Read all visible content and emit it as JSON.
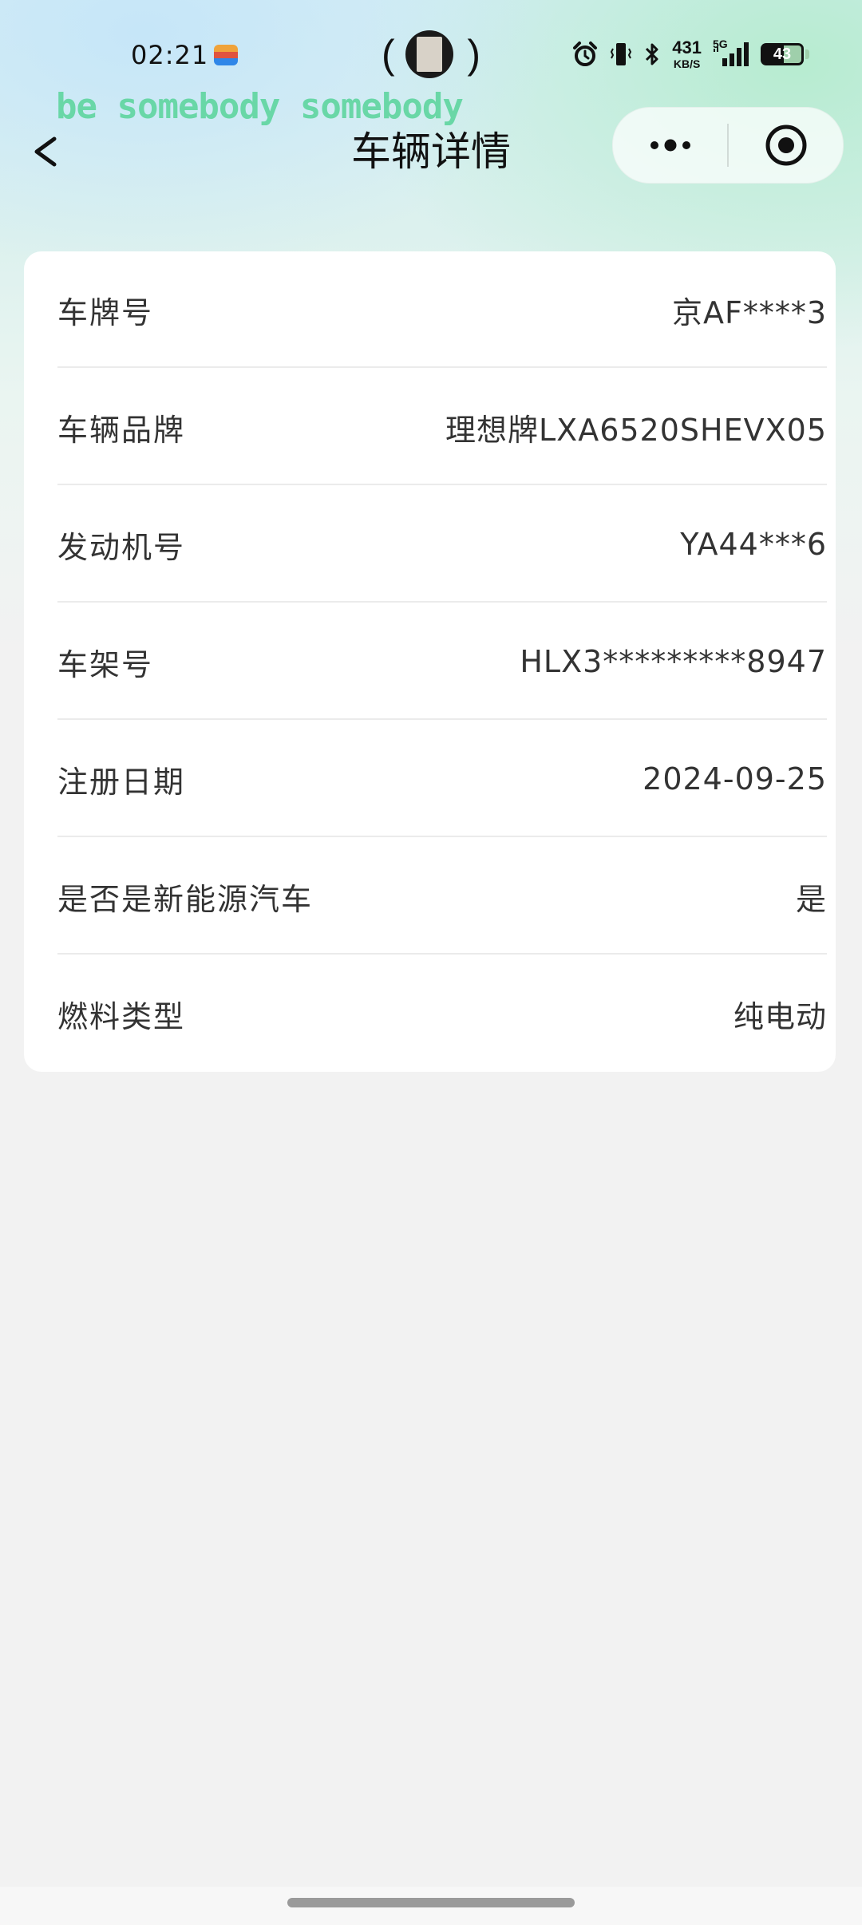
{
  "status_bar": {
    "time": "02:21",
    "net_speed_value": "431",
    "net_speed_unit": "KB/S",
    "network_type": "5G",
    "battery_level": "43",
    "icons": [
      "wallet-icon",
      "alarm-icon",
      "vibrate-icon",
      "bluetooth-icon",
      "signal-icon",
      "battery-icon"
    ]
  },
  "nav": {
    "title": "车辆详情",
    "watermark": "be somebody somebody",
    "icons": [
      "back-chevron-icon",
      "more-dots-icon",
      "close-circle-icon"
    ]
  },
  "vehicle": {
    "rows": [
      {
        "label": "车牌号",
        "value": "京AF****3"
      },
      {
        "label": "车辆品牌",
        "value": "理想牌LXA6520SHEVX05"
      },
      {
        "label": "发动机号",
        "value": "YA44***6"
      },
      {
        "label": "车架号",
        "value": "HLX3*********8947"
      },
      {
        "label": "注册日期",
        "value": "2024-09-25"
      },
      {
        "label": "是否是新能源汽车",
        "value": "是"
      },
      {
        "label": "燃料类型",
        "value": "纯电动"
      }
    ]
  },
  "colors": {
    "page_background": "#f2f2f2",
    "card_background": "#ffffff",
    "watermark_green": "#58d49a",
    "text_primary": "#111111",
    "text_secondary": "#333333"
  }
}
